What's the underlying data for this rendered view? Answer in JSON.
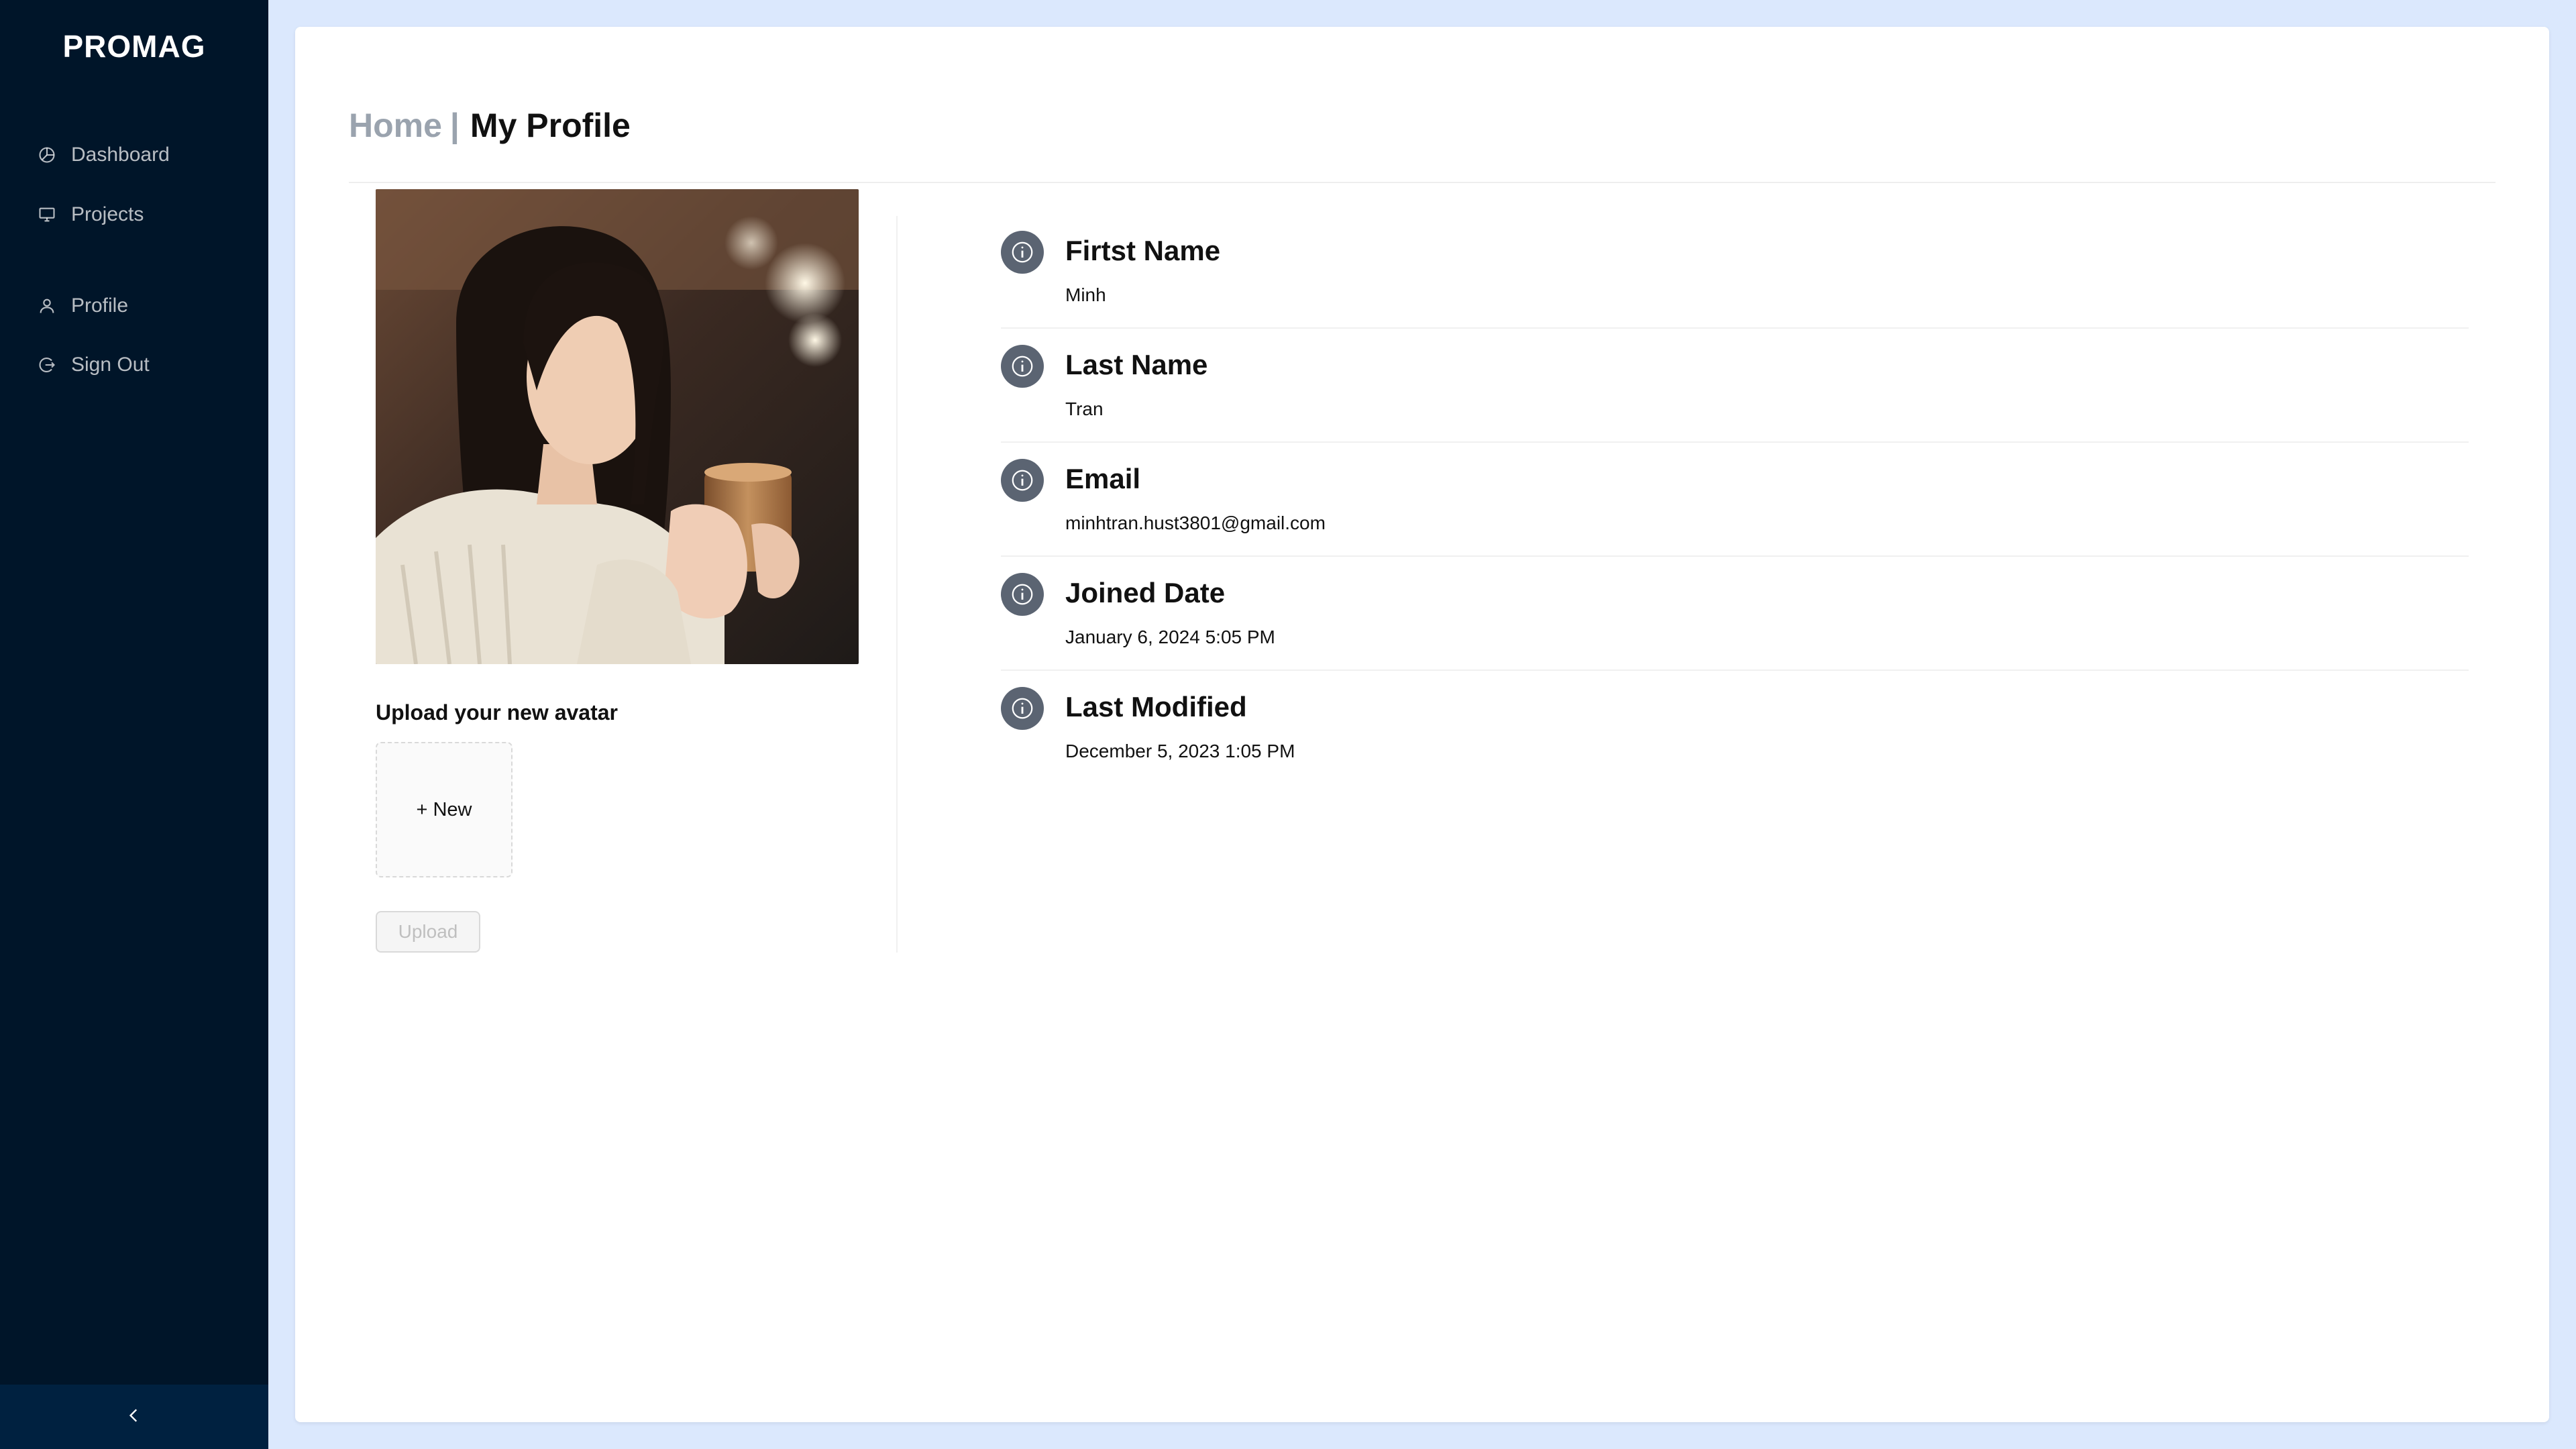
{
  "app": {
    "logo": "PROMAG"
  },
  "sidebar": {
    "items": [
      {
        "label": "Dashboard",
        "icon": "pie-chart-icon"
      },
      {
        "label": "Projects",
        "icon": "desktop-icon"
      },
      {
        "label": "Profile",
        "icon": "user-icon"
      },
      {
        "label": "Sign Out",
        "icon": "logout-icon"
      }
    ],
    "collapse_icon": "chevron-left-icon"
  },
  "breadcrumb": {
    "home": "Home",
    "separator": "|",
    "current": "My Profile"
  },
  "avatar": {
    "upload_label": "Upload your new avatar",
    "new_button": "+ New",
    "upload_button": "Upload"
  },
  "profile": {
    "fields": [
      {
        "title": "Firtst Name",
        "value": "Minh",
        "icon": "info-icon"
      },
      {
        "title": "Last Name",
        "value": "Tran",
        "icon": "info-icon"
      },
      {
        "title": "Email",
        "value": "minhtran.hust3801@gmail.com",
        "icon": "info-icon"
      },
      {
        "title": "Joined Date",
        "value": "January 6, 2024 5:05 PM",
        "icon": "info-icon"
      },
      {
        "title": "Last Modified",
        "value": "December 5, 2023 1:05 PM",
        "icon": "info-icon"
      }
    ]
  },
  "colors": {
    "sidebar_bg": "#001529",
    "page_bg": "#dbe8fd",
    "info_icon_bg": "#5b6472",
    "breadcrumb_muted": "#9aa3ae"
  }
}
